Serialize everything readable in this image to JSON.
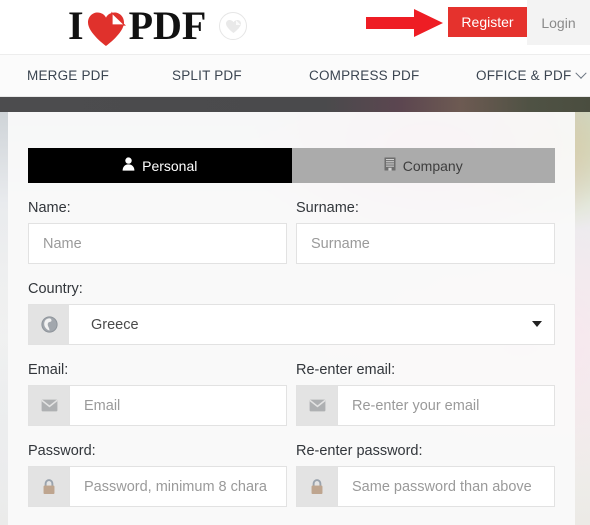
{
  "header": {
    "logo": {
      "text_before": "I",
      "text_after": "PDF",
      "heart_icon": "heart-page-icon",
      "badge_icon": "heart-circle-badge-icon"
    },
    "register_label": "Register",
    "login_label": "Login",
    "annotation_icon": "red-arrow-pointer-icon",
    "accent_red": "#e5322d"
  },
  "nav": {
    "items": [
      {
        "label": "MERGE PDF"
      },
      {
        "label": "SPLIT PDF"
      },
      {
        "label": "COMPRESS PDF"
      },
      {
        "label": "OFFICE & PDF"
      }
    ]
  },
  "form": {
    "tabs": [
      {
        "label": "Personal",
        "icon": "user-icon",
        "active": true
      },
      {
        "label": "Company",
        "icon": "building-icon",
        "active": false
      }
    ],
    "fields": {
      "name": {
        "label": "Name:",
        "placeholder": "Name",
        "value": ""
      },
      "surname": {
        "label": "Surname:",
        "placeholder": "Surname",
        "value": ""
      },
      "country": {
        "label": "Country:",
        "value": "Greece",
        "icon": "globe-icon"
      },
      "email": {
        "label": "Email:",
        "placeholder": "Email",
        "value": "",
        "icon": "envelope-icon"
      },
      "reenter_email": {
        "label": "Re-enter email:",
        "placeholder": "Re-enter your email",
        "value": "",
        "icon": "envelope-icon"
      },
      "password": {
        "label": "Password:",
        "placeholder": "Password, minimum 8 chara",
        "value": "",
        "icon": "lock-icon"
      },
      "reenter_password": {
        "label": "Re-enter password:",
        "placeholder": "Same password than above",
        "value": "",
        "icon": "lock-icon"
      }
    }
  }
}
